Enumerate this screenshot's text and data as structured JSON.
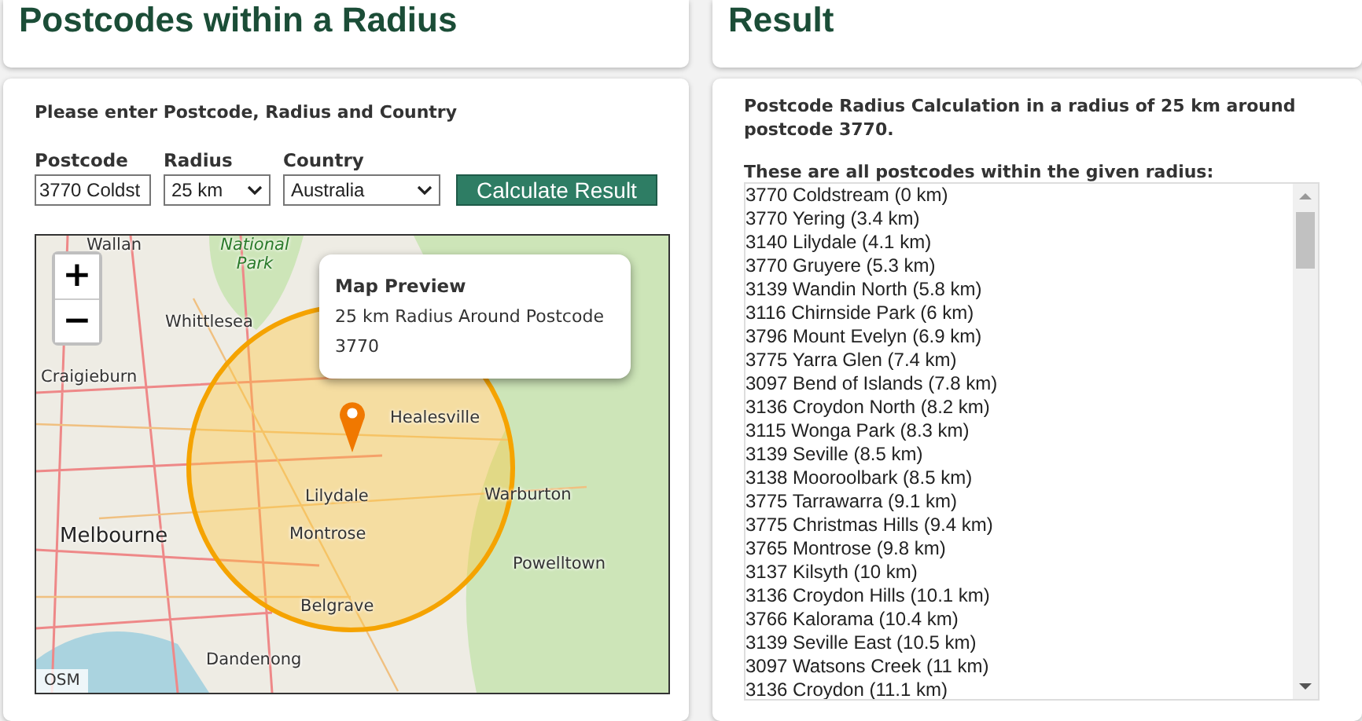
{
  "left": {
    "title": "Postcodes within a Radius",
    "instruction": "Please enter Postcode, Radius and Country",
    "fields": [
      {
        "kind": "input",
        "label": "Postcode",
        "value": "3770 Coldst"
      },
      {
        "kind": "select",
        "label": "Radius",
        "value": "25 km"
      },
      {
        "kind": "select",
        "label": "Country",
        "value": "Australia"
      }
    ],
    "button": "Calculate Result",
    "map": {
      "zoom_in": "+",
      "zoom_out": "−",
      "attribution": "OSM",
      "popup": {
        "title": "Map Preview",
        "text": "25 km Radius Around Postcode 3770"
      },
      "places": [
        {
          "name": "Wallan",
          "kind": "town"
        },
        {
          "name": "National Park",
          "kind": "park"
        },
        {
          "name": "Whittlesea",
          "kind": "town"
        },
        {
          "name": "Craigieburn",
          "kind": "town"
        },
        {
          "name": "Healesville",
          "kind": "town"
        },
        {
          "name": "Lilydale",
          "kind": "town"
        },
        {
          "name": "Warburton",
          "kind": "town"
        },
        {
          "name": "Melbourne",
          "kind": "city"
        },
        {
          "name": "Montrose",
          "kind": "town"
        },
        {
          "name": "Powelltown",
          "kind": "town"
        },
        {
          "name": "Belgrave",
          "kind": "town"
        },
        {
          "name": "Dandenong",
          "kind": "town"
        }
      ]
    }
  },
  "right": {
    "title": "Result",
    "summary": "Postcode Radius Calculation in a radius of 25 km around postcode 3770.",
    "list_heading": "These are all postcodes within the given radius:",
    "results": [
      "3770 Coldstream (0 km)",
      "3770 Yering (3.4 km)",
      "3140 Lilydale (4.1 km)",
      "3770 Gruyere (5.3 km)",
      "3139 Wandin North (5.8 km)",
      "3116 Chirnside Park (6 km)",
      "3796 Mount Evelyn (6.9 km)",
      "3775 Yarra Glen (7.4 km)",
      "3097 Bend of Islands (7.8 km)",
      "3136 Croydon North (8.2 km)",
      "3115 Wonga Park (8.3 km)",
      "3139 Seville (8.5 km)",
      "3138 Mooroolbark (8.5 km)",
      "3775 Tarrawarra (9.1 km)",
      "3775 Christmas Hills (9.4 km)",
      "3765 Montrose (9.8 km)",
      "3137 Kilsyth (10 km)",
      "3136 Croydon Hills (10.1 km)",
      "3766 Kalorama (10.4 km)",
      "3139 Seville East (10.5 km)",
      "3097 Watsons Creek (11 km)",
      "3136 Croydon (11.1 km)"
    ]
  }
}
